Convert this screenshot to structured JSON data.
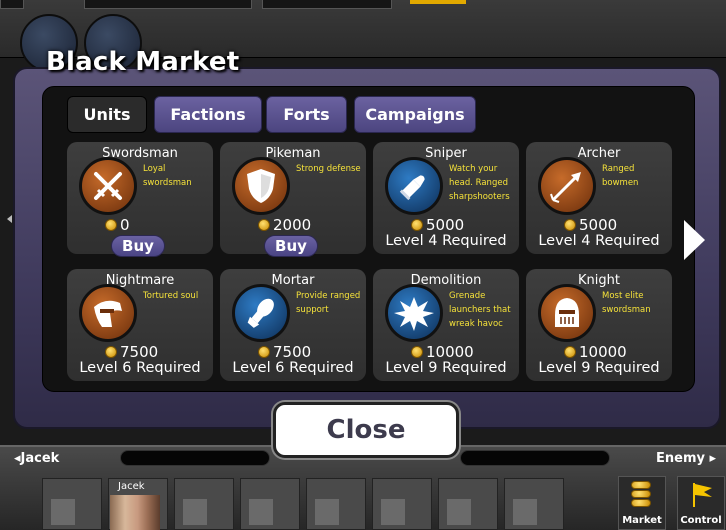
{
  "modal": {
    "title": "Black Market",
    "tabs": [
      "Units",
      "Factions",
      "Forts",
      "Campaigns"
    ],
    "close_label": "Close"
  },
  "units": [
    {
      "name": "Swordsman",
      "desc": "Loyal swordsman",
      "price": "0",
      "action": "Buy",
      "icon": "crossed-swords-icon"
    },
    {
      "name": "Pikeman",
      "desc": "Strong defense",
      "price": "2000",
      "action": "Buy",
      "icon": "shield-icon"
    },
    {
      "name": "Sniper",
      "desc": "Watch your head. Ranged sharpshooters",
      "price": "5000",
      "requirement": "Level 4 Required",
      "icon": "bullet-icon"
    },
    {
      "name": "Archer",
      "desc": "Ranged bowmen",
      "price": "5000",
      "requirement": "Level 4 Required",
      "icon": "arrow-icon"
    },
    {
      "name": "Nightmare",
      "desc": "Tortured soul",
      "price": "7500",
      "requirement": "Level 6 Required",
      "icon": "hooded-figure-icon"
    },
    {
      "name": "Mortar",
      "desc": "Provide ranged support",
      "price": "7500",
      "requirement": "Level 6 Required",
      "icon": "mortar-shell-icon"
    },
    {
      "name": "Demolition",
      "desc": "Grenade launchers that wreak havoc",
      "price": "10000",
      "requirement": "Level 9 Required",
      "icon": "explosion-icon"
    },
    {
      "name": "Knight",
      "desc": "Most elite swordsman",
      "price": "10000",
      "requirement": "Level 9 Required",
      "icon": "knight-helmet-icon"
    }
  ],
  "bottom": {
    "left_player": "Jacek",
    "right_player": "Enemy",
    "slot_player": "Jacek",
    "market_label": "Market",
    "control_label": "Control"
  }
}
